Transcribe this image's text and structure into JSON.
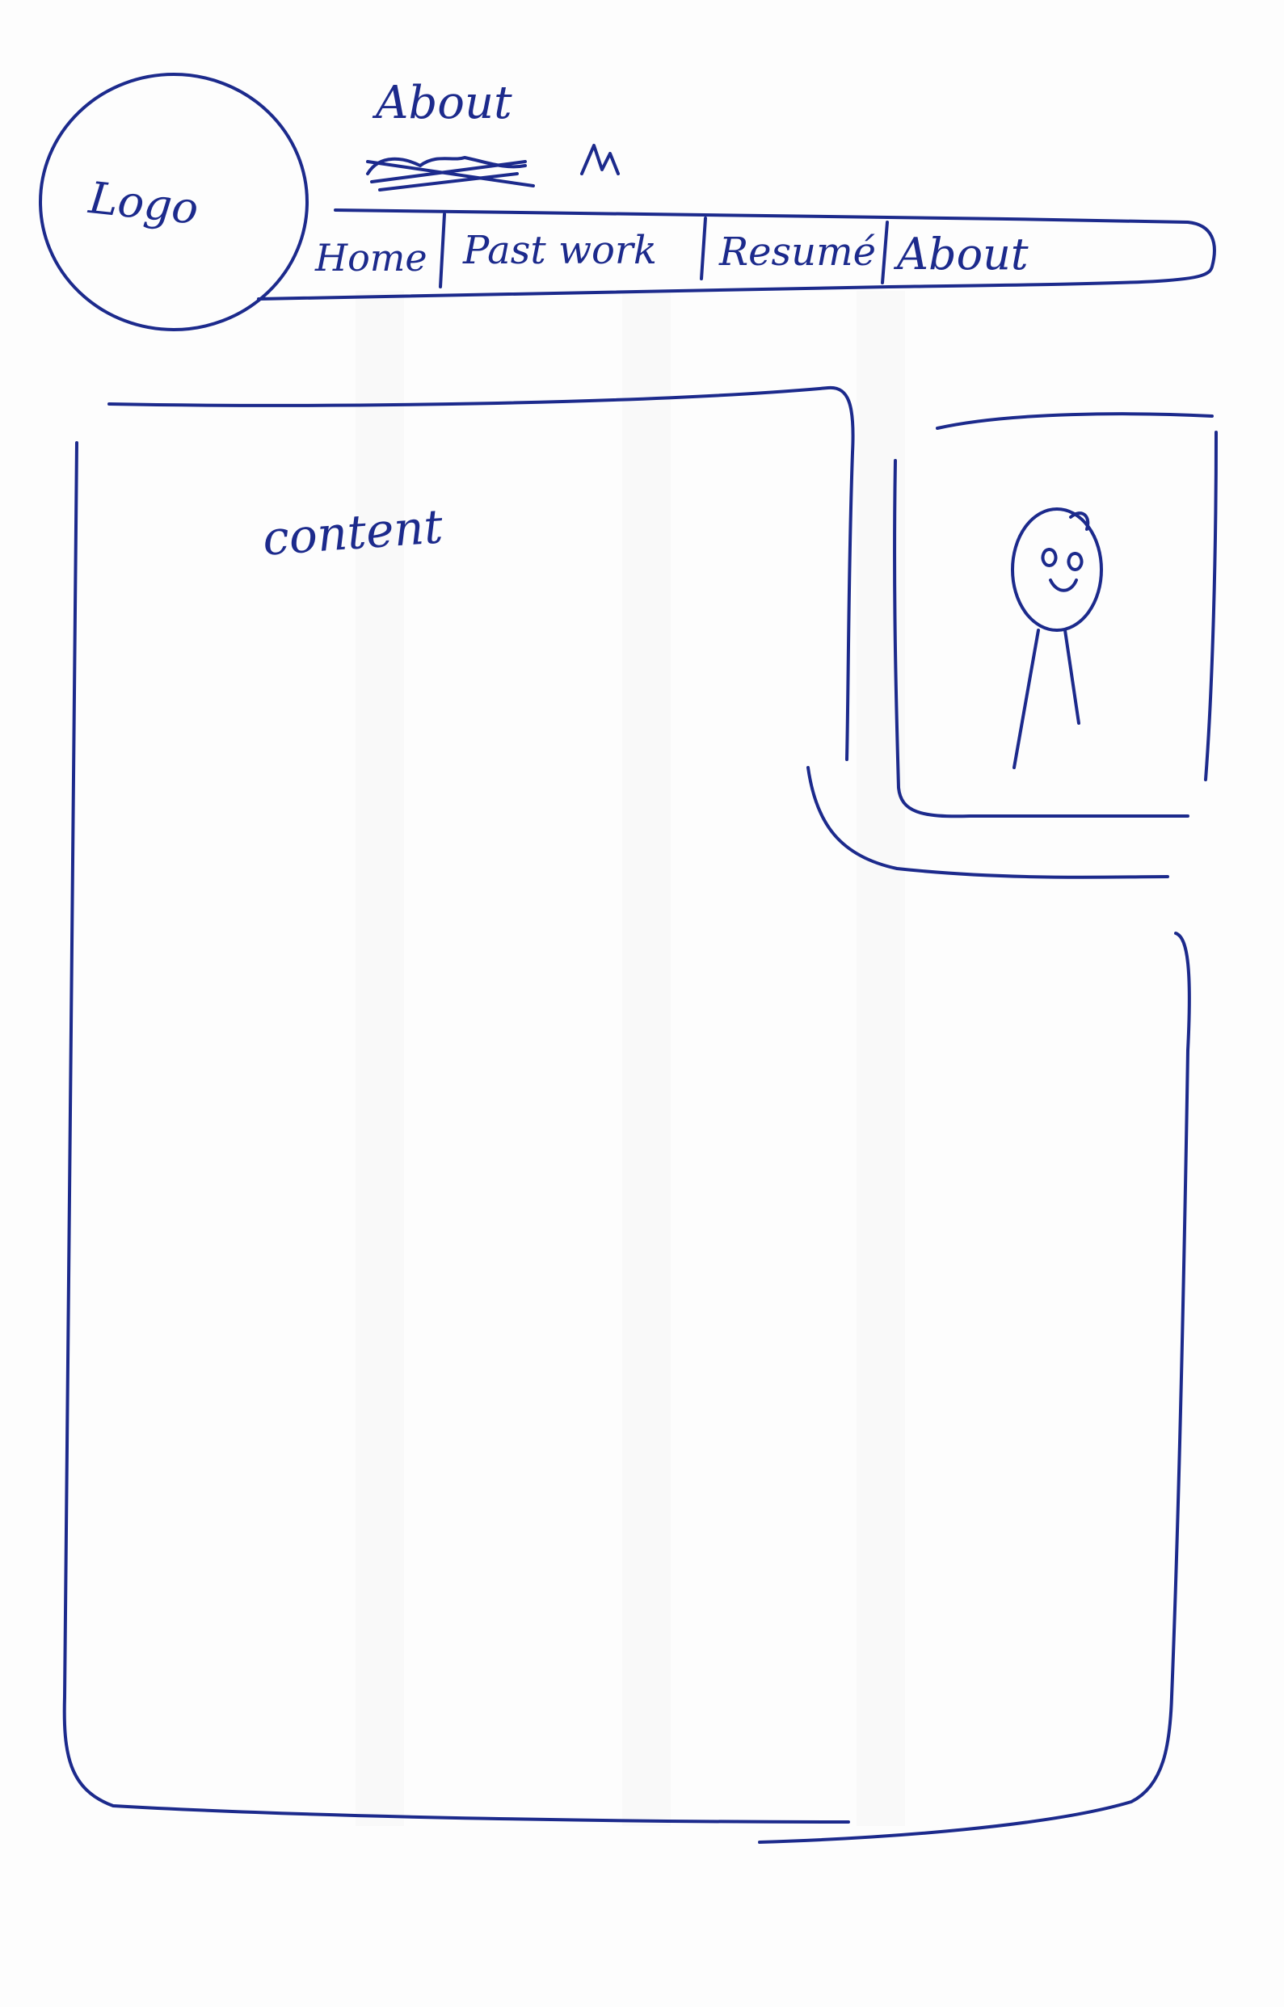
{
  "header": {
    "logo_label": "Logo",
    "annotation": "About"
  },
  "nav": {
    "items": [
      {
        "label": "Home"
      },
      {
        "label": "Past work"
      },
      {
        "label": "Resumé"
      },
      {
        "label": "About"
      }
    ]
  },
  "main": {
    "content_label": "content"
  },
  "sidebar": {
    "portrait_icon": "stick-figure-icon"
  },
  "colors": {
    "ink": "#1c2a8c",
    "paper": "#fdfdfd"
  }
}
